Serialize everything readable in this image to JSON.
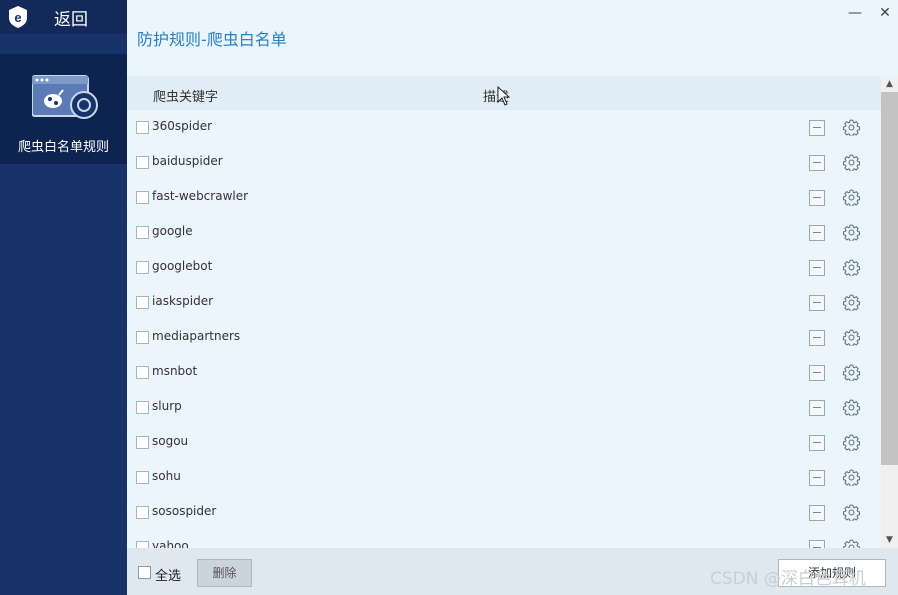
{
  "sidebar": {
    "back_label": "返回",
    "item_label": "爬虫白名单规则"
  },
  "window": {
    "minimize": "—",
    "close": "✕"
  },
  "page": {
    "title": "防护规则-爬虫白名单"
  },
  "table": {
    "columns": [
      "爬虫关键字",
      "描述"
    ],
    "rows": [
      {
        "keyword": "360spider",
        "description": ""
      },
      {
        "keyword": "baiduspider",
        "description": ""
      },
      {
        "keyword": "fast-webcrawler",
        "description": ""
      },
      {
        "keyword": "google",
        "description": ""
      },
      {
        "keyword": "googlebot",
        "description": ""
      },
      {
        "keyword": "iaskspider",
        "description": ""
      },
      {
        "keyword": "mediapartners",
        "description": ""
      },
      {
        "keyword": "msnbot",
        "description": ""
      },
      {
        "keyword": "slurp",
        "description": ""
      },
      {
        "keyword": "sogou",
        "description": ""
      },
      {
        "keyword": "sohu",
        "description": ""
      },
      {
        "keyword": "sosospider",
        "description": ""
      },
      {
        "keyword": "yahoo",
        "description": ""
      }
    ]
  },
  "footer": {
    "select_all": "全选",
    "delete": "删除",
    "add_rule": "添加规则"
  },
  "watermark": "CSDN @深白色耳机",
  "colors": {
    "sidebar": "#17336a",
    "sidebar_active": "#0e2450",
    "title": "#2b7fc4",
    "main_bg": "#ebf5fc"
  }
}
